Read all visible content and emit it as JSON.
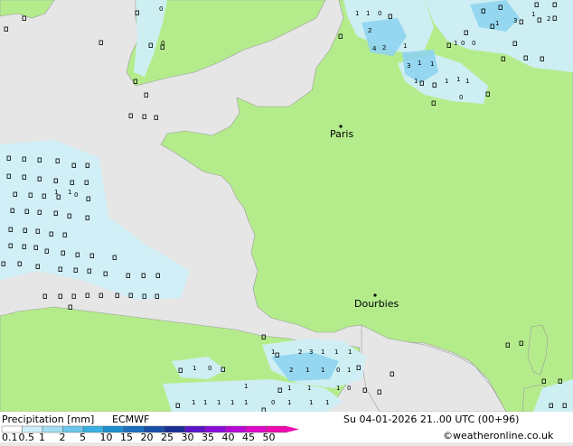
{
  "map": {
    "cities": [
      {
        "name": "Paris"
      },
      {
        "name": "Dourbies"
      }
    ],
    "precip_markers": [
      "1",
      "1",
      "0",
      "0",
      "0",
      "4",
      "2",
      "2",
      "1",
      "3",
      "1",
      "1",
      "1",
      "1",
      "1",
      "1",
      "3",
      "1",
      "2",
      "1",
      "0",
      "0",
      "1",
      "0",
      "2",
      "1",
      "1",
      "0",
      "1",
      "2",
      "3",
      "1",
      "1",
      "1",
      "1",
      "1",
      "1",
      "1",
      "0",
      "0",
      "1",
      "1",
      "1",
      "1",
      "1",
      "1",
      "0",
      "1",
      "1",
      "1",
      "1",
      "0",
      "1",
      "1"
    ]
  },
  "footer": {
    "title": "Precipitation [mm]",
    "model": "ECMWF",
    "datetime": "Su 04-01-2026 21..00 UTC (00+96)",
    "copyright": "©weatheronline.co.uk",
    "scale_labels": [
      "0.1",
      "0.5",
      "1",
      "2",
      "5",
      "10",
      "15",
      "20",
      "25",
      "30",
      "35",
      "40",
      "45",
      "50"
    ],
    "scale_colors": [
      "#ffffff",
      "#cfeff8",
      "#a3dcf0",
      "#6dc6ea",
      "#3ab0e2",
      "#1e8fd0",
      "#1c6fbe",
      "#1a4faa",
      "#1a2f96",
      "#5a14c8",
      "#8a0cd8",
      "#b808d8",
      "#e006c8",
      "#f00ab0"
    ]
  }
}
